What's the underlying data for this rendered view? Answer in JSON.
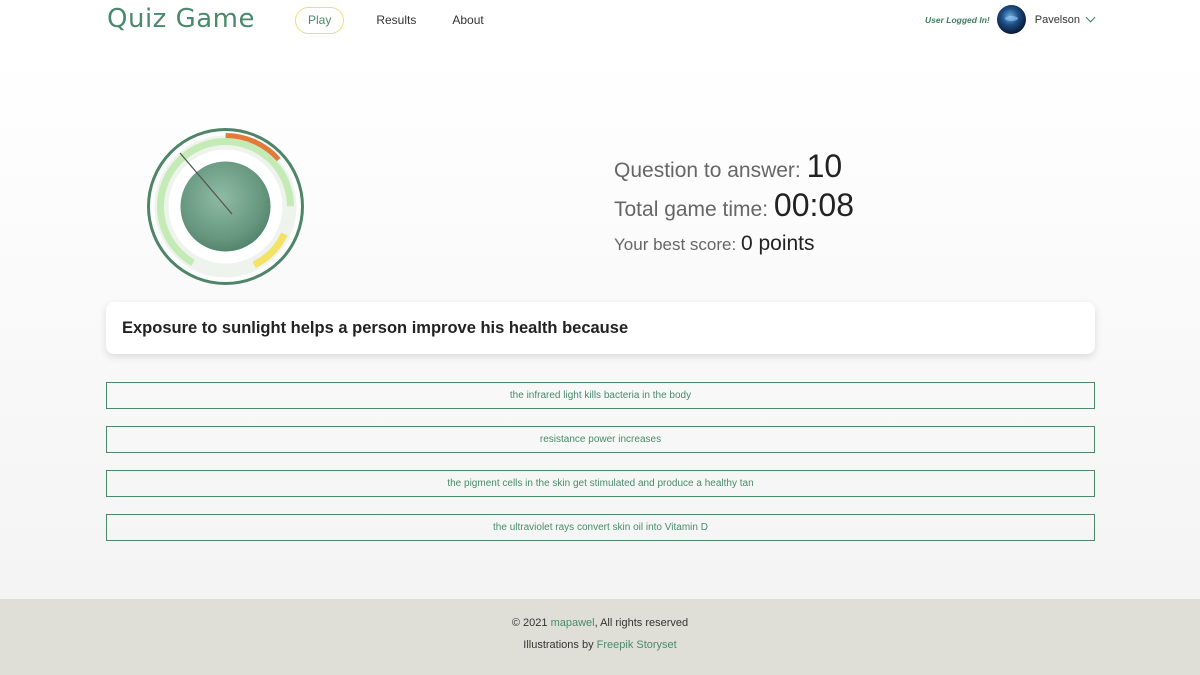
{
  "header": {
    "logo": "Quiz Game",
    "nav": [
      {
        "label": "Play",
        "active": true
      },
      {
        "label": "Results",
        "active": false
      },
      {
        "label": "About",
        "active": false
      }
    ],
    "user_status": "User Logged In!",
    "username": "Pavelson"
  },
  "stats": {
    "questions_label": "Question to answer:",
    "questions_value": "10",
    "time_label": "Total game time:",
    "time_value": "00:08",
    "best_label": "Your best score:",
    "best_value": "0 points"
  },
  "question": {
    "text": "Exposure to sunlight helps a person improve his health because"
  },
  "answers": [
    "the infrared light kills bacteria in the body",
    "resistance power increases",
    "the pigment cells in the skin get stimulated and produce a healthy tan",
    "the ultraviolet rays convert skin oil into Vitamin D"
  ],
  "footer": {
    "copyright": "© 2021",
    "author_link": "mapawel",
    "rights": ", All rights reserved",
    "illustrations_prefix": "Illustrations by",
    "illustrations_link": "Freepik Storyset"
  },
  "colors": {
    "accent": "#4a8a6b",
    "nav_active_border": "#f0dd7a",
    "dial_zone_red": "#e07a3a",
    "dial_zone_yellow": "#f0e060",
    "dial_zone_green": "#b9e6a6"
  },
  "icons": [
    "avatar",
    "chevron-down-icon"
  ]
}
